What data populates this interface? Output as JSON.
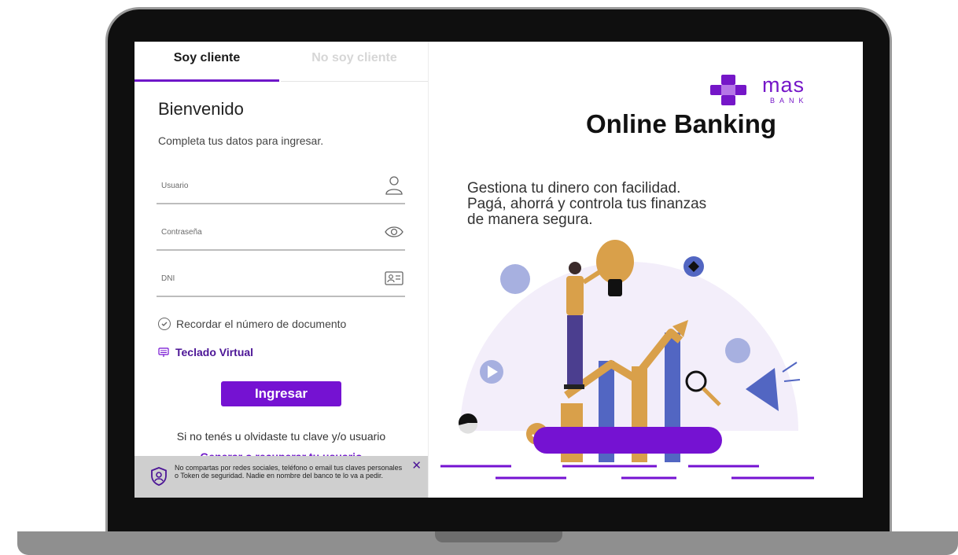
{
  "tabs": {
    "client": "Soy cliente",
    "non_client": "No soy cliente"
  },
  "login": {
    "welcome": "Bienvenido",
    "subtitle": "Completa tus datos para ingresar.",
    "user_placeholder": "Usuario",
    "password_placeholder": "Contraseña",
    "dni_placeholder": "DNI",
    "remember_label": "Recordar el número de documento",
    "virtual_keyboard": "Teclado Virtual",
    "submit": "Ingresar",
    "help_text": "Si no tenés u olvidaste tu clave y/o usuario",
    "help_link": "Generar o recuperar tu usuario"
  },
  "toast": {
    "message": "No compartas por redes sociales, teléfono o email tus claves personales o Token de seguridad. Nadie en nombre del banco te lo va a pedir.",
    "close": "✕"
  },
  "brand": {
    "logo_text": "mas",
    "logo_sub": "BANK",
    "title": "Online Banking",
    "tagline_lines": [
      "Gestiona tu dinero con facilidad.",
      "Pagá, ahorrá y controla tus finanzas",
      "de manera segura."
    ]
  },
  "colors": {
    "primary": "#7512d2",
    "link": "#4c1596",
    "orange": "#d9a04a",
    "blue": "#5266c2",
    "lavender": "#a7b0e0"
  },
  "icons": {
    "user": "user-icon",
    "password": "eye-icon",
    "dni": "id-card-icon",
    "keyboard": "keyboard-icon",
    "shield": "shield-icon"
  }
}
